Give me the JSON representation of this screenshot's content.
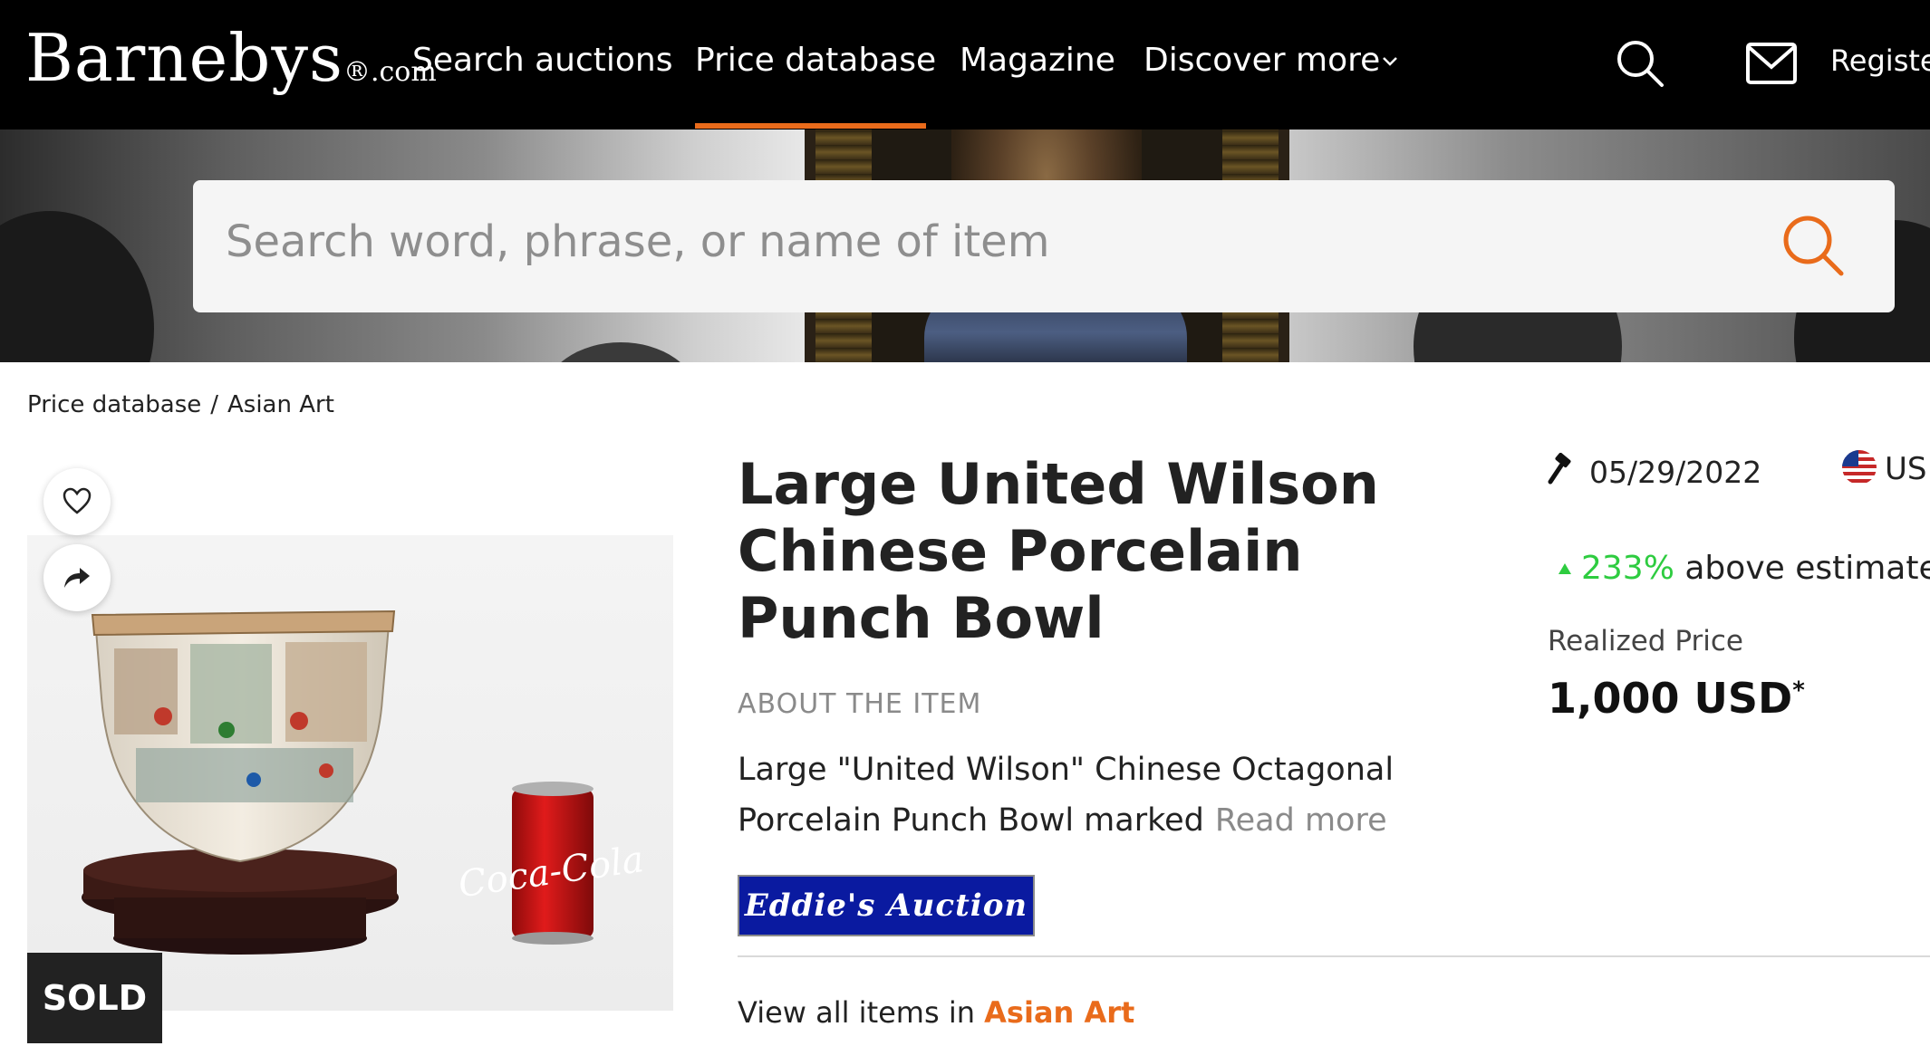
{
  "header": {
    "logo_text": "Barnebys",
    "logo_suffix": "®.com",
    "nav": [
      {
        "label": "Search auctions"
      },
      {
        "label": "Price database"
      },
      {
        "label": "Magazine"
      },
      {
        "label": "Discover more"
      }
    ],
    "register_label": "Registe",
    "accent_color": "#e96b1b"
  },
  "search": {
    "placeholder": "Search word, phrase, or name of item"
  },
  "breadcrumb": {
    "items": [
      "Price database",
      "Asian Art"
    ],
    "separator": "/"
  },
  "item": {
    "title": "Large United Wilson Chinese Porcelain Punch Bowl",
    "about_heading": "ABOUT THE ITEM",
    "description": "Large \"United Wilson\" Chinese Octagonal Porcelain Punch Bowl marked",
    "read_more": "Read more",
    "sold_label": "SOLD",
    "auction_house_logo": "Eddie's Auction",
    "view_all_prefix": "View all items in",
    "view_all_category": "Asian Art",
    "can_label_text": "Coca-Cola"
  },
  "sale": {
    "date": "05/29/2022",
    "currency": "US",
    "estimate_pct": "233%",
    "estimate_text": "above estimate",
    "realized_label": "Realized Price",
    "realized_value": "1,000 USD",
    "realized_footnote": "*",
    "positive_color": "#2ecc40"
  },
  "icons": [
    "chevron-down-icon",
    "search-icon",
    "mail-icon",
    "heart-icon",
    "share-icon",
    "gavel-icon",
    "us-flag-icon",
    "arrow-up-icon"
  ]
}
